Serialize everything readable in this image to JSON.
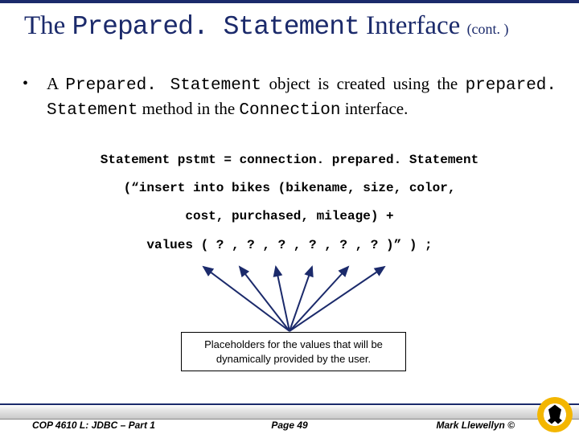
{
  "title": {
    "pre": "The ",
    "mono": "Prepared. Statement",
    "post": " Interface ",
    "cont": "(cont. )"
  },
  "bullet": {
    "mark": "•",
    "t1": "A ",
    "m1": "Prepared. Statement",
    "t2": " object is created using the ",
    "m2": "prepared. Statement",
    "t3": " method in the ",
    "m3": "Connection",
    "t4": " interface."
  },
  "code": {
    "l1": "Statement pstmt = connection. prepared. Statement",
    "l2": "(“insert into bikes (bikename, size, color,",
    "l3": "cost, purchased, mileage) +",
    "l4": "values ( ? , ? , ? , ? , ? , ? )” ) ;"
  },
  "callout": "Placeholders for the values that will be dynamically provided by the user.",
  "footer": {
    "left": "COP 4610 L: JDBC – Part 1",
    "center": "Page 49",
    "right": "Mark Llewellyn ©"
  }
}
